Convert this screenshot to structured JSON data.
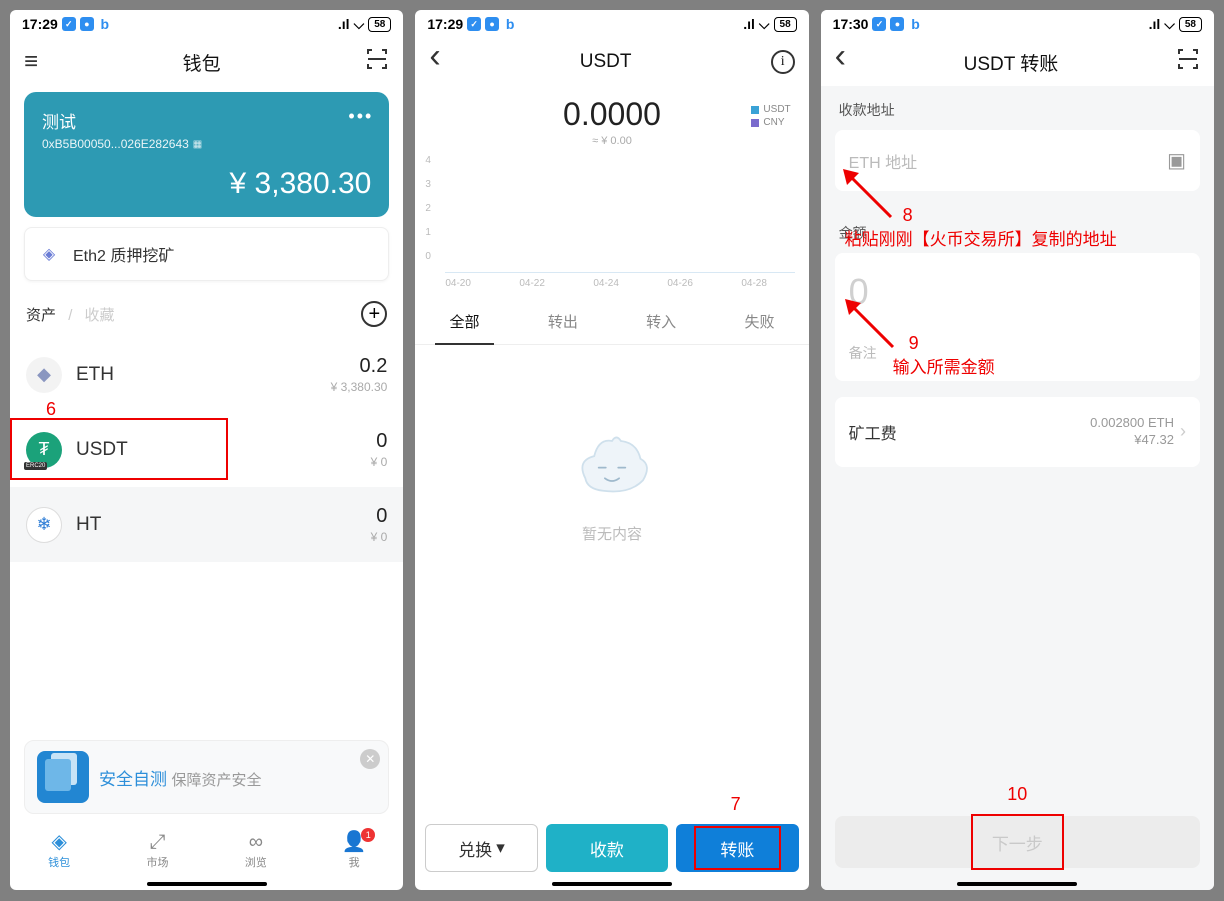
{
  "screen1": {
    "status_time": "17:29",
    "status_battery": "58",
    "title": "钱包",
    "wallet": {
      "name": "测试",
      "address": "0xB5B00050...026E282643",
      "balance": "¥ 3,380.30"
    },
    "eth2": "Eth2 质押挖矿",
    "tabs": {
      "assets": "资产",
      "fav": "收藏"
    },
    "assets": [
      {
        "symbol": "ETH",
        "amount": "0.2",
        "fiat": "¥ 3,380.30"
      },
      {
        "symbol": "USDT",
        "amount": "0",
        "fiat": "¥ 0"
      },
      {
        "symbol": "HT",
        "amount": "0",
        "fiat": "¥ 0"
      }
    ],
    "banner": {
      "title": "安全自测",
      "sub": "保障资产安全"
    },
    "bottom": {
      "wallet": "钱包",
      "market": "市场",
      "browse": "浏览",
      "me": "我",
      "notif": "1"
    },
    "ann": "6"
  },
  "screen2": {
    "status_time": "17:29",
    "status_battery": "58",
    "title": "USDT",
    "amount": "0.0000",
    "fiat": "≈ ¥ 0.00",
    "legend": {
      "a": "USDT",
      "b": "CNY"
    },
    "y": {
      "v4": "4",
      "v3": "3",
      "v2": "2",
      "v1": "1",
      "v0": "0"
    },
    "x": {
      "x0": "04-20",
      "x1": "04-22",
      "x2": "04-24",
      "x3": "04-26",
      "x4": "04-28"
    },
    "txtabs": {
      "all": "全部",
      "out": "转出",
      "in": "转入",
      "fail": "失败"
    },
    "empty": "暂无内容",
    "actions": {
      "exchange": "兑换",
      "receive": "收款",
      "send": "转账"
    },
    "ann": "7"
  },
  "screen3": {
    "status_time": "17:30",
    "status_battery": "58",
    "title": "USDT 转账",
    "addr_label": "收款地址",
    "addr_ph": "ETH 地址",
    "amt_label": "金额",
    "amt_ph": "0",
    "note_label": "备注",
    "fee_label": "矿工费",
    "fee_eth": "0.002800 ETH",
    "fee_cny": "¥47.32",
    "next": "下一步",
    "ann8_num": "8",
    "ann8_txt": "粘贴刚刚【火币交易所】复制的地址",
    "ann9_num": "9",
    "ann9_txt": "输入所需金额",
    "ann10": "10"
  }
}
